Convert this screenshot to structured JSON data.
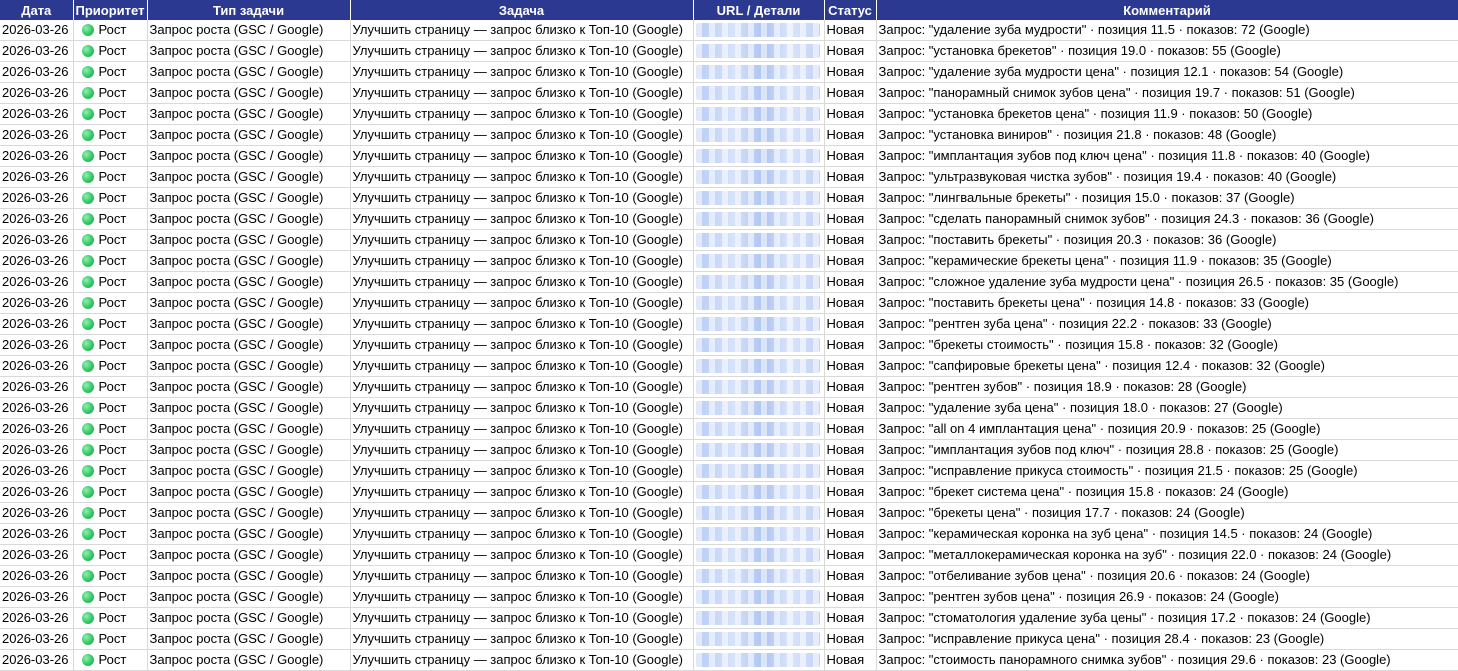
{
  "headers": [
    "Дата",
    "Приоритет",
    "Тип задачи",
    "Задача",
    "URL / Детали",
    "Статус",
    "Комментарий"
  ],
  "rows": [
    {
      "date": "2026-03-26",
      "priority": "Рост",
      "type": "Запрос роста (GSC / Google)",
      "task": "Улучшить страницу — запрос близко к Топ-10 (Google)",
      "status": "Новая",
      "comment": "Запрос: \"удаление зуба мудрости\" · позиция 11.5 · показов: 72 (Google)"
    },
    {
      "date": "2026-03-26",
      "priority": "Рост",
      "type": "Запрос роста (GSC / Google)",
      "task": "Улучшить страницу — запрос близко к Топ-10 (Google)",
      "status": "Новая",
      "comment": "Запрос: \"установка брекетов\" · позиция 19.0 · показов: 55 (Google)"
    },
    {
      "date": "2026-03-26",
      "priority": "Рост",
      "type": "Запрос роста (GSC / Google)",
      "task": "Улучшить страницу — запрос близко к Топ-10 (Google)",
      "status": "Новая",
      "comment": "Запрос: \"удаление зуба мудрости цена\" · позиция 12.1 · показов: 54 (Google)"
    },
    {
      "date": "2026-03-26",
      "priority": "Рост",
      "type": "Запрос роста (GSC / Google)",
      "task": "Улучшить страницу — запрос близко к Топ-10 (Google)",
      "status": "Новая",
      "comment": "Запрос: \"панорамный снимок зубов цена\" · позиция 19.7 · показов: 51 (Google)"
    },
    {
      "date": "2026-03-26",
      "priority": "Рост",
      "type": "Запрос роста (GSC / Google)",
      "task": "Улучшить страницу — запрос близко к Топ-10 (Google)",
      "status": "Новая",
      "comment": "Запрос: \"установка брекетов цена\" · позиция 11.9 · показов: 50 (Google)"
    },
    {
      "date": "2026-03-26",
      "priority": "Рост",
      "type": "Запрос роста (GSC / Google)",
      "task": "Улучшить страницу — запрос близко к Топ-10 (Google)",
      "status": "Новая",
      "comment": "Запрос: \"установка виниров\" · позиция 21.8 · показов: 48 (Google)"
    },
    {
      "date": "2026-03-26",
      "priority": "Рост",
      "type": "Запрос роста (GSC / Google)",
      "task": "Улучшить страницу — запрос близко к Топ-10 (Google)",
      "status": "Новая",
      "comment": "Запрос: \"имплантация зубов под ключ цена\" · позиция 11.8 · показов: 40 (Google)"
    },
    {
      "date": "2026-03-26",
      "priority": "Рост",
      "type": "Запрос роста (GSC / Google)",
      "task": "Улучшить страницу — запрос близко к Топ-10 (Google)",
      "status": "Новая",
      "comment": "Запрос: \"ультразвуковая чистка зубов\" · позиция 19.4 · показов: 40 (Google)"
    },
    {
      "date": "2026-03-26",
      "priority": "Рост",
      "type": "Запрос роста (GSC / Google)",
      "task": "Улучшить страницу — запрос близко к Топ-10 (Google)",
      "status": "Новая",
      "comment": "Запрос: \"лингвальные брекеты\" · позиция 15.0 · показов: 37 (Google)"
    },
    {
      "date": "2026-03-26",
      "priority": "Рост",
      "type": "Запрос роста (GSC / Google)",
      "task": "Улучшить страницу — запрос близко к Топ-10 (Google)",
      "status": "Новая",
      "comment": "Запрос: \"сделать панорамный снимок зубов\" · позиция 24.3 · показов: 36 (Google)"
    },
    {
      "date": "2026-03-26",
      "priority": "Рост",
      "type": "Запрос роста (GSC / Google)",
      "task": "Улучшить страницу — запрос близко к Топ-10 (Google)",
      "status": "Новая",
      "comment": "Запрос: \"поставить брекеты\" · позиция 20.3 · показов: 36 (Google)"
    },
    {
      "date": "2026-03-26",
      "priority": "Рост",
      "type": "Запрос роста (GSC / Google)",
      "task": "Улучшить страницу — запрос близко к Топ-10 (Google)",
      "status": "Новая",
      "comment": "Запрос: \"керамические брекеты цена\" · позиция 11.9 · показов: 35 (Google)"
    },
    {
      "date": "2026-03-26",
      "priority": "Рост",
      "type": "Запрос роста (GSC / Google)",
      "task": "Улучшить страницу — запрос близко к Топ-10 (Google)",
      "status": "Новая",
      "comment": "Запрос: \"сложное удаление зуба мудрости цена\" · позиция 26.5 · показов: 35 (Google)"
    },
    {
      "date": "2026-03-26",
      "priority": "Рост",
      "type": "Запрос роста (GSC / Google)",
      "task": "Улучшить страницу — запрос близко к Топ-10 (Google)",
      "status": "Новая",
      "comment": "Запрос: \"поставить брекеты цена\" · позиция 14.8 · показов: 33 (Google)"
    },
    {
      "date": "2026-03-26",
      "priority": "Рост",
      "type": "Запрос роста (GSC / Google)",
      "task": "Улучшить страницу — запрос близко к Топ-10 (Google)",
      "status": "Новая",
      "comment": "Запрос: \"рентген зуба цена\" · позиция 22.2 · показов: 33 (Google)"
    },
    {
      "date": "2026-03-26",
      "priority": "Рост",
      "type": "Запрос роста (GSC / Google)",
      "task": "Улучшить страницу — запрос близко к Топ-10 (Google)",
      "status": "Новая",
      "comment": "Запрос: \"брекеты стоимость\" · позиция 15.8 · показов: 32 (Google)"
    },
    {
      "date": "2026-03-26",
      "priority": "Рост",
      "type": "Запрос роста (GSC / Google)",
      "task": "Улучшить страницу — запрос близко к Топ-10 (Google)",
      "status": "Новая",
      "comment": "Запрос: \"сапфировые брекеты цена\" · позиция 12.4 · показов: 32 (Google)"
    },
    {
      "date": "2026-03-26",
      "priority": "Рост",
      "type": "Запрос роста (GSC / Google)",
      "task": "Улучшить страницу — запрос близко к Топ-10 (Google)",
      "status": "Новая",
      "comment": "Запрос: \"рентген зубов\" · позиция 18.9 · показов: 28 (Google)"
    },
    {
      "date": "2026-03-26",
      "priority": "Рост",
      "type": "Запрос роста (GSC / Google)",
      "task": "Улучшить страницу — запрос близко к Топ-10 (Google)",
      "status": "Новая",
      "comment": "Запрос: \"удаление зуба цена\" · позиция 18.0 · показов: 27 (Google)"
    },
    {
      "date": "2026-03-26",
      "priority": "Рост",
      "type": "Запрос роста (GSC / Google)",
      "task": "Улучшить страницу — запрос близко к Топ-10 (Google)",
      "status": "Новая",
      "comment": "Запрос: \"all on 4 имплантация цена\" · позиция 20.9 · показов: 25 (Google)"
    },
    {
      "date": "2026-03-26",
      "priority": "Рост",
      "type": "Запрос роста (GSC / Google)",
      "task": "Улучшить страницу — запрос близко к Топ-10 (Google)",
      "status": "Новая",
      "comment": "Запрос: \"имплантация зубов под ключ\" · позиция 28.8 · показов: 25 (Google)"
    },
    {
      "date": "2026-03-26",
      "priority": "Рост",
      "type": "Запрос роста (GSC / Google)",
      "task": "Улучшить страницу — запрос близко к Топ-10 (Google)",
      "status": "Новая",
      "comment": "Запрос: \"исправление прикуса стоимость\" · позиция 21.5 · показов: 25 (Google)"
    },
    {
      "date": "2026-03-26",
      "priority": "Рост",
      "type": "Запрос роста (GSC / Google)",
      "task": "Улучшить страницу — запрос близко к Топ-10 (Google)",
      "status": "Новая",
      "comment": "Запрос: \"брекет система цена\" · позиция 15.8 · показов: 24 (Google)"
    },
    {
      "date": "2026-03-26",
      "priority": "Рост",
      "type": "Запрос роста (GSC / Google)",
      "task": "Улучшить страницу — запрос близко к Топ-10 (Google)",
      "status": "Новая",
      "comment": "Запрос: \"брекеты цена\" · позиция 17.7 · показов: 24 (Google)"
    },
    {
      "date": "2026-03-26",
      "priority": "Рост",
      "type": "Запрос роста (GSC / Google)",
      "task": "Улучшить страницу — запрос близко к Топ-10 (Google)",
      "status": "Новая",
      "comment": "Запрос: \"керамическая коронка на зуб цена\" · позиция 14.5 · показов: 24 (Google)"
    },
    {
      "date": "2026-03-26",
      "priority": "Рост",
      "type": "Запрос роста (GSC / Google)",
      "task": "Улучшить страницу — запрос близко к Топ-10 (Google)",
      "status": "Новая",
      "comment": "Запрос: \"металлокерамическая коронка на зуб\" · позиция 22.0 · показов: 24 (Google)"
    },
    {
      "date": "2026-03-26",
      "priority": "Рост",
      "type": "Запрос роста (GSC / Google)",
      "task": "Улучшить страницу — запрос близко к Топ-10 (Google)",
      "status": "Новая",
      "comment": "Запрос: \"отбеливание зубов цена\" · позиция 20.6 · показов: 24 (Google)"
    },
    {
      "date": "2026-03-26",
      "priority": "Рост",
      "type": "Запрос роста (GSC / Google)",
      "task": "Улучшить страницу — запрос близко к Топ-10 (Google)",
      "status": "Новая",
      "comment": "Запрос: \"рентген зубов цена\" · позиция 26.9 · показов: 24 (Google)"
    },
    {
      "date": "2026-03-26",
      "priority": "Рост",
      "type": "Запрос роста (GSC / Google)",
      "task": "Улучшить страницу — запрос близко к Топ-10 (Google)",
      "status": "Новая",
      "comment": "Запрос: \"стоматология удаление зуба цены\" · позиция 17.2 · показов: 24 (Google)"
    },
    {
      "date": "2026-03-26",
      "priority": "Рост",
      "type": "Запрос роста (GSC / Google)",
      "task": "Улучшить страницу — запрос близко к Топ-10 (Google)",
      "status": "Новая",
      "comment": "Запрос: \"исправление прикуса цена\" · позиция 28.4 · показов: 23 (Google)"
    },
    {
      "date": "2026-03-26",
      "priority": "Рост",
      "type": "Запрос роста (GSC / Google)",
      "task": "Улучшить страницу — запрос близко к Топ-10 (Google)",
      "status": "Новая",
      "comment": "Запрос: \"стоимость панорамного снимка зубов\" · позиция 29.6 · показов: 23 (Google)"
    }
  ]
}
